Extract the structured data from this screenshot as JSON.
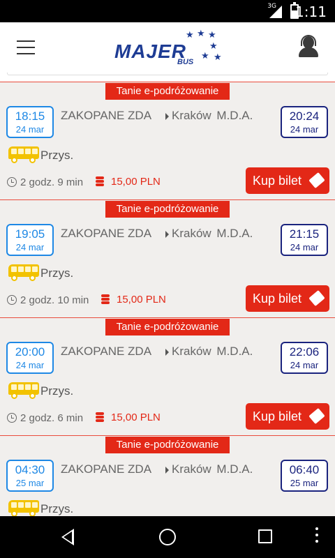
{
  "statusbar": {
    "network": "3G",
    "time": "1:11"
  },
  "header": {
    "logo_text": "MAJER",
    "logo_sub": "BUS"
  },
  "trips": [
    {
      "badge": "Tanie e-podróżowanie",
      "dep_time": "18:15",
      "dep_date": "24 mar",
      "from": "ZAKOPANE ZDA",
      "to": "Kraków  M.D.A.",
      "arr_time": "20:24",
      "arr_date": "24 mar",
      "service": "Przys.",
      "duration": "2 godz. 9 min",
      "price": "15,00 PLN",
      "buy_label": "Kup bilet"
    },
    {
      "badge": "Tanie e-podróżowanie",
      "dep_time": "19:05",
      "dep_date": "24 mar",
      "from": "ZAKOPANE ZDA",
      "to": "Kraków  M.D.A.",
      "arr_time": "21:15",
      "arr_date": "24 mar",
      "service": "Przys.",
      "duration": "2 godz. 10 min",
      "price": "15,00 PLN",
      "buy_label": "Kup bilet"
    },
    {
      "badge": "Tanie e-podróżowanie",
      "dep_time": "20:00",
      "dep_date": "24 mar",
      "from": "ZAKOPANE ZDA",
      "to": "Kraków  M.D.A.",
      "arr_time": "22:06",
      "arr_date": "24 mar",
      "service": "Przys.",
      "duration": "2 godz. 6 min",
      "price": "15,00 PLN",
      "buy_label": "Kup bilet"
    },
    {
      "badge": "Tanie e-podróżowanie",
      "dep_time": "04:30",
      "dep_date": "25 mar",
      "from": "ZAKOPANE ZDA",
      "to": "Kraków  M.D.A.",
      "arr_time": "06:40",
      "arr_date": "25 mar",
      "service": "Przys.",
      "duration": "",
      "price": "",
      "buy_label": ""
    }
  ],
  "colors": {
    "accent_red": "#e32817",
    "brand_blue": "#1e3c94",
    "dep_blue": "#1e88e5",
    "arr_navy": "#1a237e",
    "bus_yellow": "#f2c200"
  }
}
